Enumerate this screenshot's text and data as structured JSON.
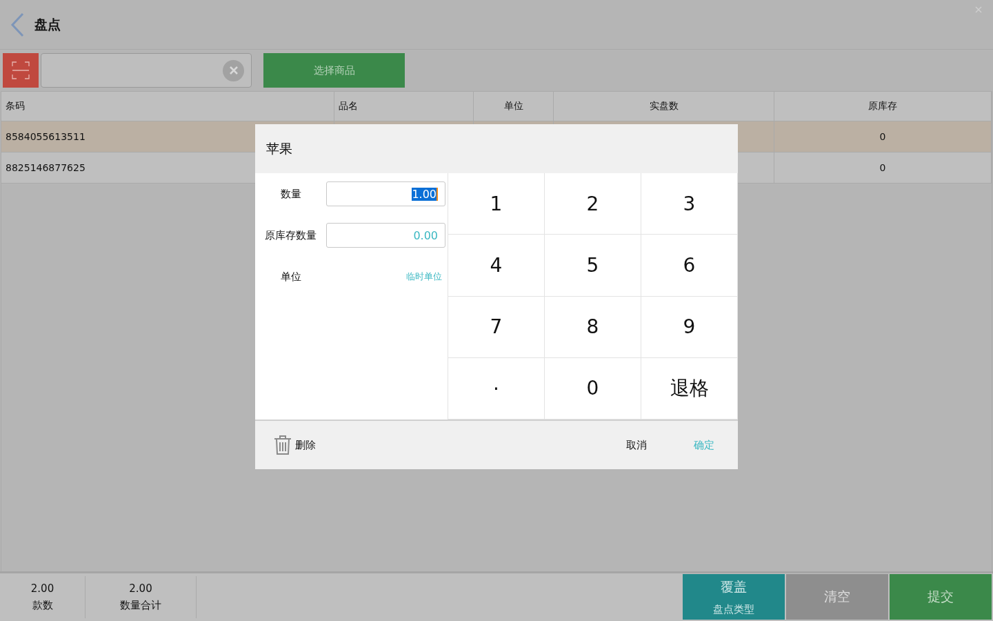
{
  "header": {
    "title": "盘点"
  },
  "toolbar": {
    "select_button": "选择商品"
  },
  "table": {
    "columns": [
      "条码",
      "品名",
      "单位",
      "实盘数",
      "原库存"
    ],
    "rows": [
      {
        "barcode": "8584055613511",
        "stock": "0",
        "selected": true
      },
      {
        "barcode": "8825146877625",
        "stock": "0",
        "selected": false
      }
    ]
  },
  "dialog": {
    "title": "苹果",
    "fields": [
      {
        "label": "数量",
        "value": "1.00",
        "highlighted": true
      },
      {
        "label": "原库存数量",
        "value": "0.00",
        "highlighted": false
      }
    ],
    "unit": {
      "label": "单位",
      "link": "临时单位"
    },
    "keys": [
      {
        "kind": "digit",
        "label": "1"
      },
      {
        "kind": "digit",
        "label": "2"
      },
      {
        "kind": "digit",
        "label": "3"
      },
      {
        "kind": "digit",
        "label": "4"
      },
      {
        "kind": "digit",
        "label": "5"
      },
      {
        "kind": "digit",
        "label": "6"
      },
      {
        "kind": "digit",
        "label": "7"
      },
      {
        "kind": "digit",
        "label": "8"
      },
      {
        "kind": "digit",
        "label": "9"
      },
      {
        "kind": "point",
        "label": "."
      },
      {
        "kind": "digit",
        "label": "0"
      },
      {
        "kind": "backspace",
        "label": "退格"
      }
    ],
    "delete": "删除",
    "cancel": "取消",
    "confirm": "确定"
  },
  "footer": {
    "stats": [
      {
        "value": "2.00",
        "label": "款数"
      },
      {
        "value": "2.00",
        "label": "数量合计"
      }
    ],
    "buttons": [
      {
        "kind": "mode",
        "label": "覆盖",
        "sublabel": "盘点类型"
      },
      {
        "kind": "clear",
        "label": "清空"
      },
      {
        "kind": "submit",
        "label": "提交"
      }
    ]
  }
}
